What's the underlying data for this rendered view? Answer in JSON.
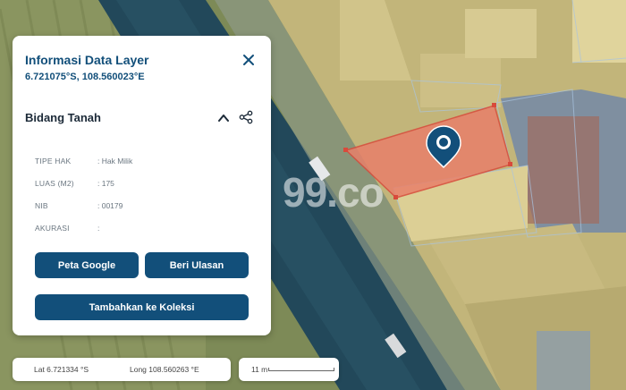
{
  "panel": {
    "title": "Informasi Data Layer",
    "coords": "6.721075°S, 108.560023°E",
    "section_title": "Bidang Tanah",
    "rows": [
      {
        "label": "TIPE HAK",
        "value": ": Hak Milik"
      },
      {
        "label": "LUAS (M2)",
        "value": ": 175"
      },
      {
        "label": "NIB",
        "value": ": 00179"
      },
      {
        "label": "AKURASI",
        "value": ":"
      }
    ],
    "buttons": {
      "google": "Peta Google",
      "review": "Beri Ulasan",
      "collection": "Tambahkan ke Koleksi"
    }
  },
  "footer": {
    "lat": "Lat 6.721334 °S",
    "long": "Long 108.560263 °E",
    "scale": "11 m"
  },
  "watermark": "99.co",
  "icons": [
    "close-icon",
    "chevron-up-icon",
    "share-icon",
    "location-pin-icon"
  ],
  "colors": {
    "primary": "#124f7a",
    "parcel_selected": "#e8806a",
    "parcel_fill": "#d2c489",
    "road": "#23485a"
  }
}
